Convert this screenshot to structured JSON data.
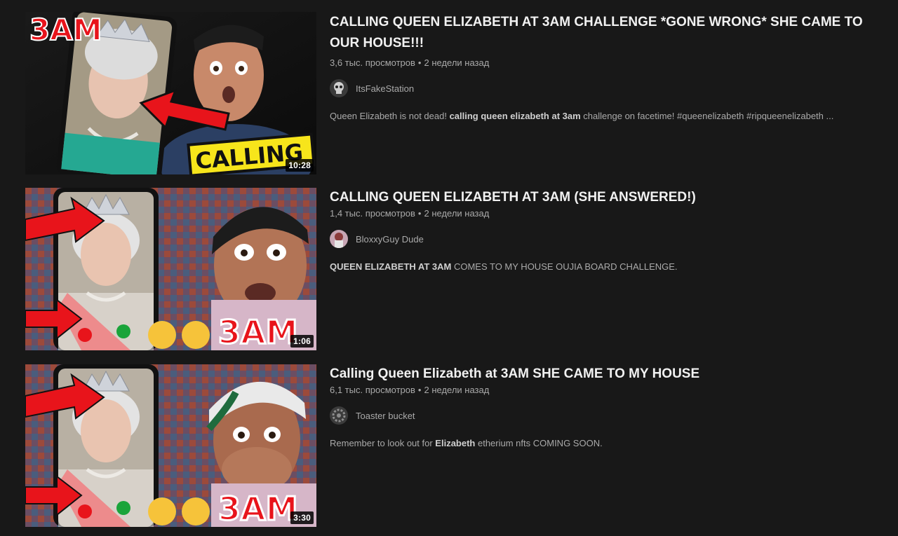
{
  "videos": [
    {
      "title": "CALLING QUEEN ELIZABETH AT 3AM CHALLENGE *GONE WRONG* SHE CAME TO OUR HOUSE!!!",
      "views": "3,6 тыс. просмотров",
      "separator": "•",
      "age": "2 недели назад",
      "channel": "ItsFakeStation",
      "duration": "10:28",
      "thumb_text_top": "3AM",
      "thumb_text_bottom": "CALLING",
      "description": {
        "pre": "Queen Elizabeth is not dead! ",
        "bold": "calling queen elizabeth at 3am",
        "post": " challenge on facetime! #queenelizabeth #ripqueenelizabeth ..."
      },
      "avatar_icon": "skull-avatar-icon"
    },
    {
      "title": "CALLING QUEEN ELIZABETH AT 3AM (SHE ANSWERED!)",
      "views": "1,4 тыс. просмотров",
      "separator": "•",
      "age": "2 недели назад",
      "channel": "BloxxyGuy Dude",
      "duration": "1:06",
      "thumb_text": "3AM",
      "description": {
        "pre": "",
        "bold": "QUEEN ELIZABETH AT 3AM",
        "post": " COMES TO MY HOUSE OUJIA BOARD CHALLENGE."
      },
      "avatar_icon": "character-avatar-icon"
    },
    {
      "title": "Calling Queen Elizabeth at 3AM SHE CAME TO MY HOUSE",
      "views": "6,1 тыс. просмотров",
      "separator": "•",
      "age": "2 недели назад",
      "channel": "Toaster bucket",
      "duration": "3:30",
      "thumb_text": "3AM",
      "description": {
        "pre": "Remember to look out for ",
        "bold": "Elizabeth",
        "post": " etherium nfts COMING SOON."
      },
      "avatar_icon": "gear-avatar-icon"
    }
  ],
  "colors": {
    "background": "#181818",
    "title": "#f1f1f1",
    "secondary": "#aaaaaa",
    "accent_red": "#e8141b",
    "accent_yellow": "#f7e51b"
  }
}
